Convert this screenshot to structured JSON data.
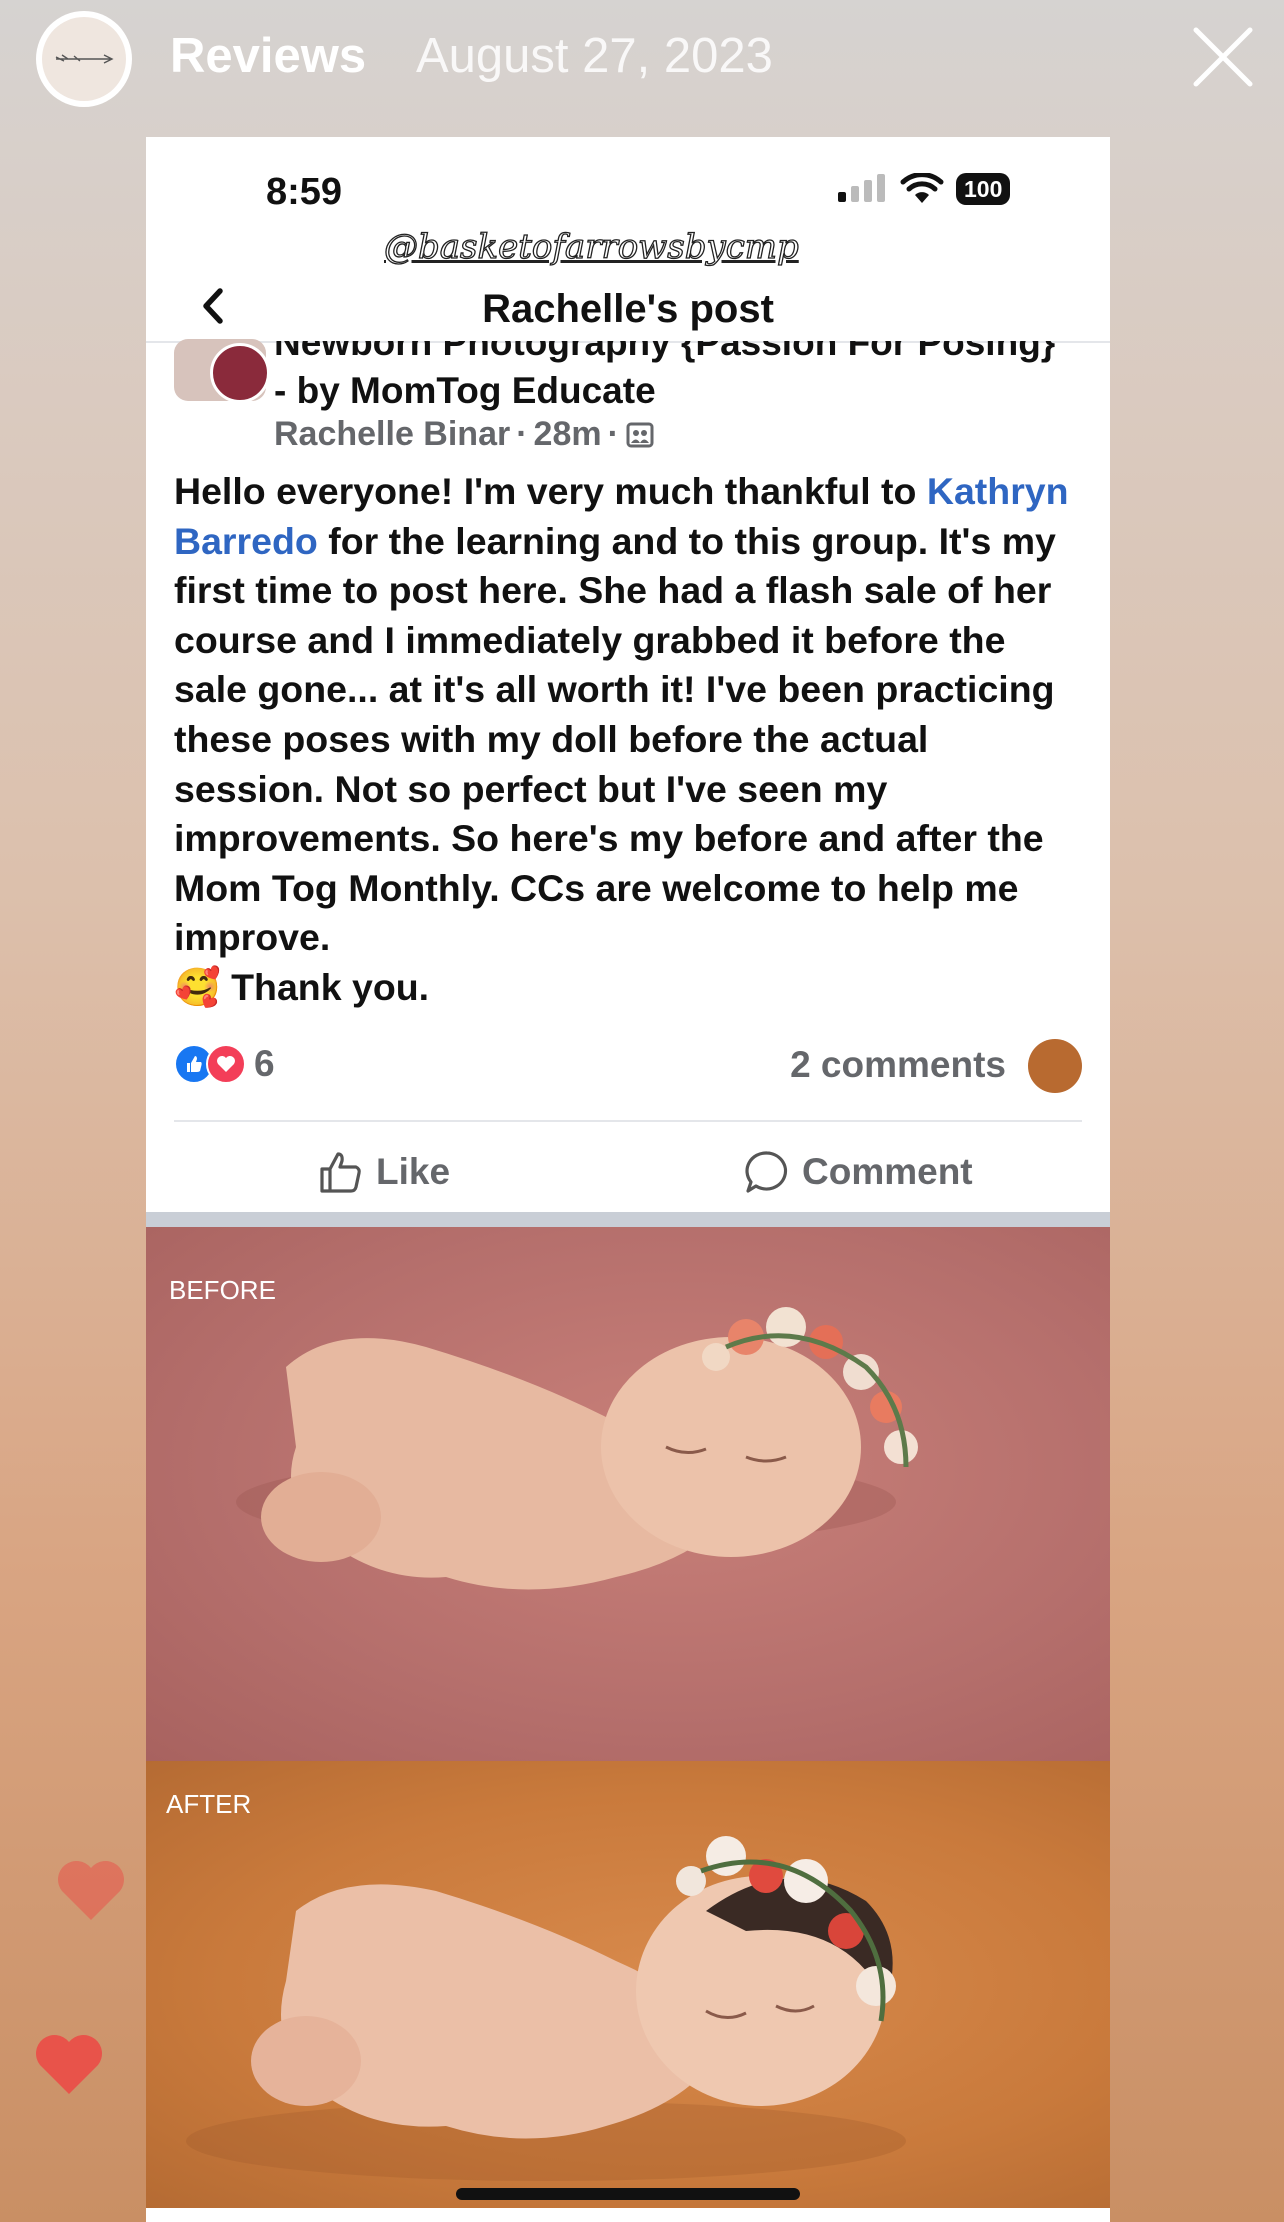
{
  "story": {
    "title": "Reviews",
    "date": "August 27, 2023",
    "close_icon": "close-icon"
  },
  "phone": {
    "time": "8:59",
    "battery": "100",
    "watermark": "@basketofarrowsbycmp"
  },
  "nav": {
    "title": "Rachelle's post"
  },
  "post": {
    "group_name": "Newborn Photography {Passion For Posing} - by MomTog Educate",
    "author": "Rachelle Binar",
    "time_ago": "28m",
    "separator": "·",
    "text_before_mention": "Hello everyone! I'm very much thankful to",
    "mention": "Kathryn Barredo",
    "text_after_mention": "for the learning and to this group. It's my first time to post here. She had a flash sale of her course and I immediately grabbed it before the sale gone... at it's all worth it! I've been practicing these poses with my doll before the actual session. Not so perfect but I've seen my improvements. So here's my before and after the Mom Tog Monthly. CCs are welcome to help me improve.",
    "emoji": "🥰",
    "closing": "Thank you.",
    "reaction_count": "6",
    "comments": "2 comments",
    "like_label": "Like",
    "comment_label": "Comment"
  },
  "photos": {
    "before_label": "BEFORE",
    "after_label": "AFTER"
  },
  "colors": {
    "mention": "#2f66c2",
    "like_blue": "#1877f2",
    "love_red": "#f33e58",
    "heart": "#e8534a"
  }
}
